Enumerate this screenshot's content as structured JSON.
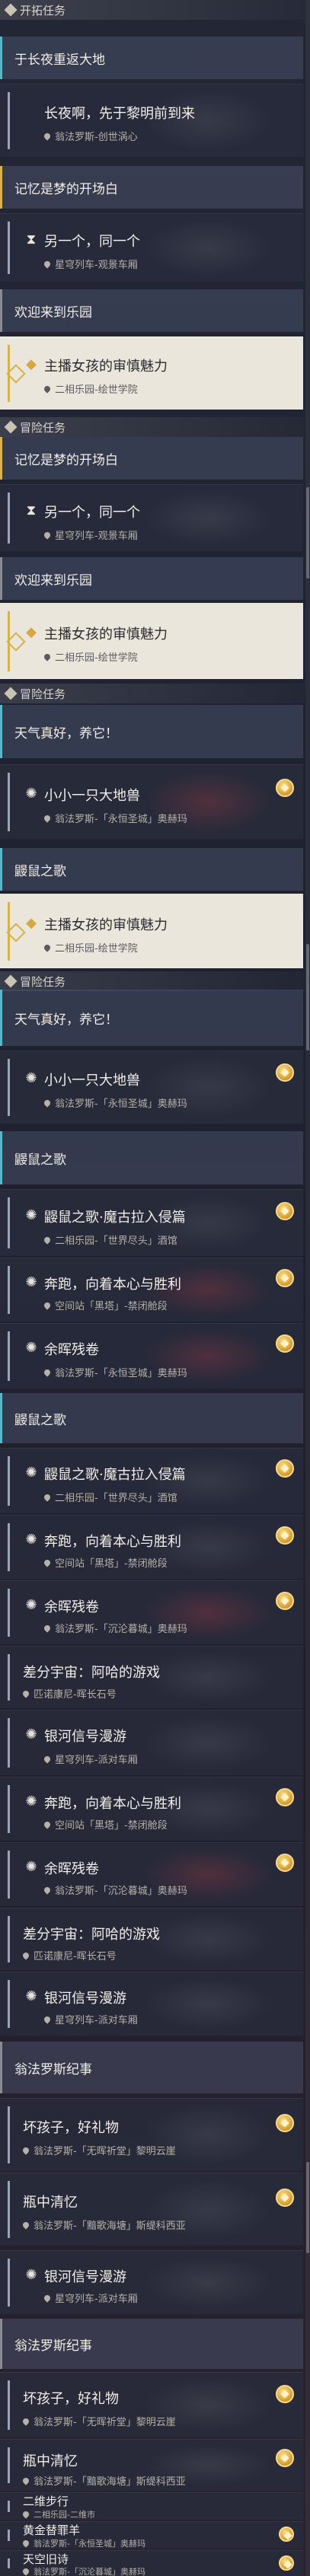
{
  "sections": {
    "s1": "开拓任务",
    "s2": "冒险任务",
    "s3": "冒险任务",
    "s4": "冒险任务"
  },
  "chapters": {
    "c1": "于长夜重返大地",
    "c2": "记忆是梦的开场白",
    "c3": "欢迎来到乐园",
    "c4": "记忆是梦的开场白",
    "c5": "欢迎来到乐园",
    "c6": "天气真好，养它！",
    "c7": "鼹鼠之歌",
    "c8": "天气真好，养它！",
    "c9": "鼹鼠之歌",
    "c10": "鼹鼠之歌",
    "c11": "翁法罗斯纪事",
    "c12": "翁法罗斯纪事"
  },
  "quests": {
    "q1": {
      "title": "长夜啊，先于黎明前到来",
      "loc": "翁法罗斯-创世涡心"
    },
    "q2": {
      "title": "另一个，同一个",
      "loc": "星穹列车-观景车厢"
    },
    "q3": {
      "title": "主播女孩的审慎魅力",
      "loc": "二相乐园-绘世学院"
    },
    "q4": {
      "title": "另一个，同一个",
      "loc": "星穹列车-观景车厢"
    },
    "q5": {
      "title": "主播女孩的审慎魅力",
      "loc": "二相乐园-绘世学院"
    },
    "q6": {
      "title": "小小一只大地兽",
      "loc": "翁法罗斯-「永恒圣城」奥赫玛"
    },
    "q7": {
      "title": "主播女孩的审慎魅力",
      "loc": "二相乐园-绘世学院"
    },
    "q8": {
      "title": "小小一只大地兽",
      "loc": "翁法罗斯-「永恒圣城」奥赫玛"
    },
    "q9": {
      "title": "鼹鼠之歌·魔古拉入侵篇",
      "loc": "二相乐园-「世界尽头」酒馆"
    },
    "q10": {
      "title": "奔跑，向着本心与胜利",
      "loc": "空间站「黑塔」-禁闭舱段"
    },
    "q11": {
      "title": "余晖残卷",
      "loc": "翁法罗斯-「永恒圣城」奥赫玛"
    },
    "q12": {
      "title": "鼹鼠之歌·魔古拉入侵篇",
      "loc": "二相乐园-「世界尽头」酒馆"
    },
    "q13": {
      "title": "奔跑，向着本心与胜利",
      "loc": "空间站「黑塔」-禁闭舱段"
    },
    "q14": {
      "title": "余晖残卷",
      "loc": "翁法罗斯-「沉沦暮城」奥赫玛"
    },
    "q15": {
      "title": "差分宇宙：阿哈的游戏",
      "loc": "匹诺康尼-晖长石号"
    },
    "q16": {
      "title": "银河信号漫游",
      "loc": "星穹列车-派对车厢"
    },
    "q17": {
      "title": "奔跑，向着本心与胜利",
      "loc": "空间站「黑塔」-禁闭舱段"
    },
    "q18": {
      "title": "余晖残卷",
      "loc": "翁法罗斯-「沉沦暮城」奥赫玛"
    },
    "q19": {
      "title": "差分宇宙：阿哈的游戏",
      "loc": "匹诺康尼-晖长石号"
    },
    "q20": {
      "title": "银河信号漫游",
      "loc": "星穹列车-派对车厢"
    },
    "q21": {
      "title": "坏孩子，好礼物",
      "loc": "翁法罗斯-「无晖祈堂」黎明云崖"
    },
    "q22": {
      "title": "瓶中清忆",
      "loc": "翁法罗斯-「黯歌海塘」斯缇科西亚"
    },
    "q23": {
      "title": "银河信号漫游",
      "loc": "星穹列车-派对车厢"
    },
    "q24": {
      "title": "坏孩子，好礼物",
      "loc": "翁法罗斯-「无晖祈堂」黎明云崖"
    },
    "q25": {
      "title": "瓶中清忆",
      "loc": "翁法罗斯-「黯歌海塘」斯缇科西亚"
    },
    "q26": {
      "title": "二维步行",
      "loc": "二相乐园-二维市"
    },
    "q27": {
      "title": "黄金替罪羊",
      "loc": "翁法罗斯-「永恒圣城」奥赫玛"
    },
    "q28": {
      "title": "天空旧诗",
      "loc": "翁法罗斯-「沉沦暮城」奥赫玛"
    }
  },
  "icons": {
    "section": "diamond-icon",
    "quest_trailblaze": "hourglass-icon",
    "quest_adventure": "swirl-icon",
    "location": "pin-icon",
    "reward": "reward-medal-icon"
  },
  "colors": {
    "accent_cyan": "#5bb6c8",
    "accent_gold": "#d5b24a",
    "selected_bg": "#eae6dc"
  }
}
